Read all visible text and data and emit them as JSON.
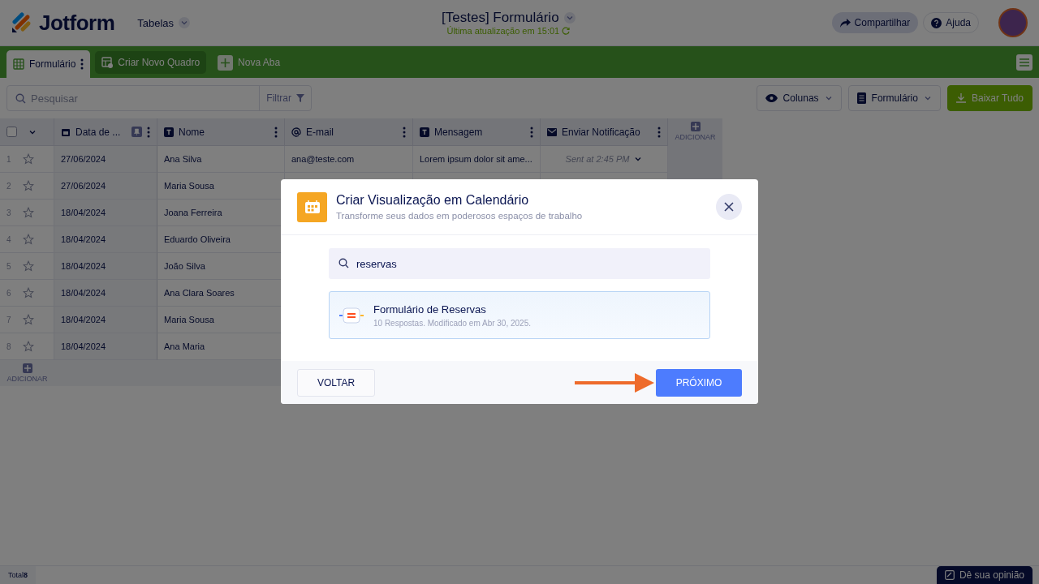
{
  "header": {
    "logo": "Jotform",
    "section": "Tabelas",
    "title": "[Testes] Formulário",
    "updated": "Última atualização em 15:01",
    "buttons": [
      {
        "kind": "share",
        "label": "Compartilhar"
      },
      {
        "kind": "help",
        "label": "Ajuda"
      }
    ]
  },
  "tabs": [
    {
      "kind": "sheet",
      "label": "Formulário",
      "selected": true
    },
    {
      "kind": "board",
      "label": "Criar Novo Quadro",
      "selected": false
    },
    {
      "kind": "add",
      "label": "Nova Aba",
      "selected": false
    }
  ],
  "toolbar": {
    "search_placeholder": "Pesquisar",
    "filter": "Filtrar",
    "columns_button": "Colunas",
    "form_button": "Formulário",
    "download": "Baixar Tudo"
  },
  "table": {
    "columns": [
      {
        "kind": "date",
        "label": "Data de ..."
      },
      {
        "kind": "text",
        "label": "Nome"
      },
      {
        "kind": "email",
        "label": "E-mail"
      },
      {
        "kind": "text",
        "label": "Mensagem"
      },
      {
        "kind": "mail",
        "label": "Enviar Notificação"
      }
    ],
    "select_all": {
      "checked": false
    },
    "add_column": "ADICIONAR",
    "rows": [
      {
        "n": "1",
        "cells": [
          "27/06/2024",
          "Ana Silva",
          "ana@teste.com",
          "Lorem ipsum dolor sit ame...",
          "Sent at 2:45 PM"
        ]
      },
      {
        "n": "2",
        "cells": [
          "27/06/2024",
          "Maria Sousa"
        ]
      },
      {
        "n": "3",
        "cells": [
          "18/04/2024",
          "Joana Ferreira"
        ]
      },
      {
        "n": "4",
        "cells": [
          "18/04/2024",
          "Eduardo Oliveira"
        ]
      },
      {
        "n": "5",
        "cells": [
          "18/04/2024",
          "João Silva"
        ]
      },
      {
        "n": "6",
        "cells": [
          "18/04/2024",
          "Ana Clara Soares"
        ]
      },
      {
        "n": "7",
        "cells": [
          "18/04/2024",
          "Maria Sousa"
        ]
      },
      {
        "n": "8",
        "cells": [
          "18/04/2024",
          "Ana Maria"
        ]
      }
    ],
    "add_row": "ADICIONAR"
  },
  "status_bar": {
    "total_label": "Total",
    "total": "8",
    "feedback": "Dê sua opinião"
  },
  "modal": {
    "title": "Criar Visualização em Calendário",
    "subtitle": "Transforme seus dados em poderosos espaços de trabalho",
    "search_value": "reservas",
    "results": [
      {
        "title": "Formulário de Reservas",
        "meta": "10 Respostas. Modificado em Abr 30, 2025.",
        "selected": true
      }
    ],
    "back": "VOLTAR",
    "next": "PRÓXIMO"
  }
}
